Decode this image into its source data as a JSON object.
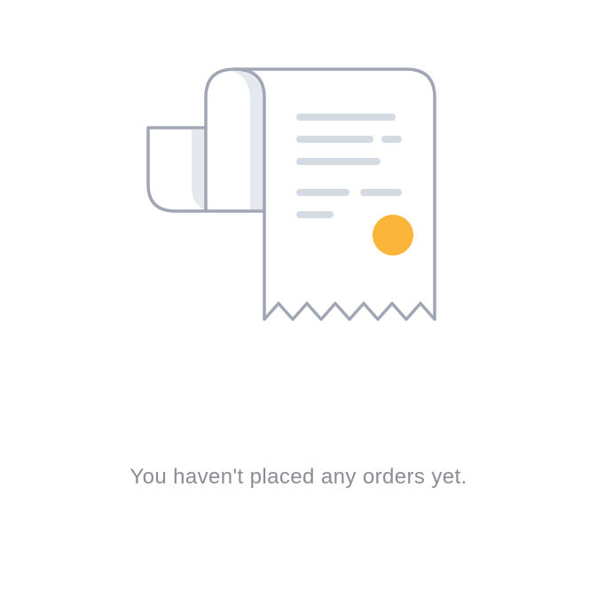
{
  "empty_state": {
    "message": "You haven't placed any orders yet."
  },
  "illustration": {
    "icon": "receipt-icon",
    "colors": {
      "outline": "#a1a6b4",
      "fold_shade": "#e5e9ee",
      "text_lines": "#d4dae1",
      "seal": "#fbb63a"
    }
  }
}
